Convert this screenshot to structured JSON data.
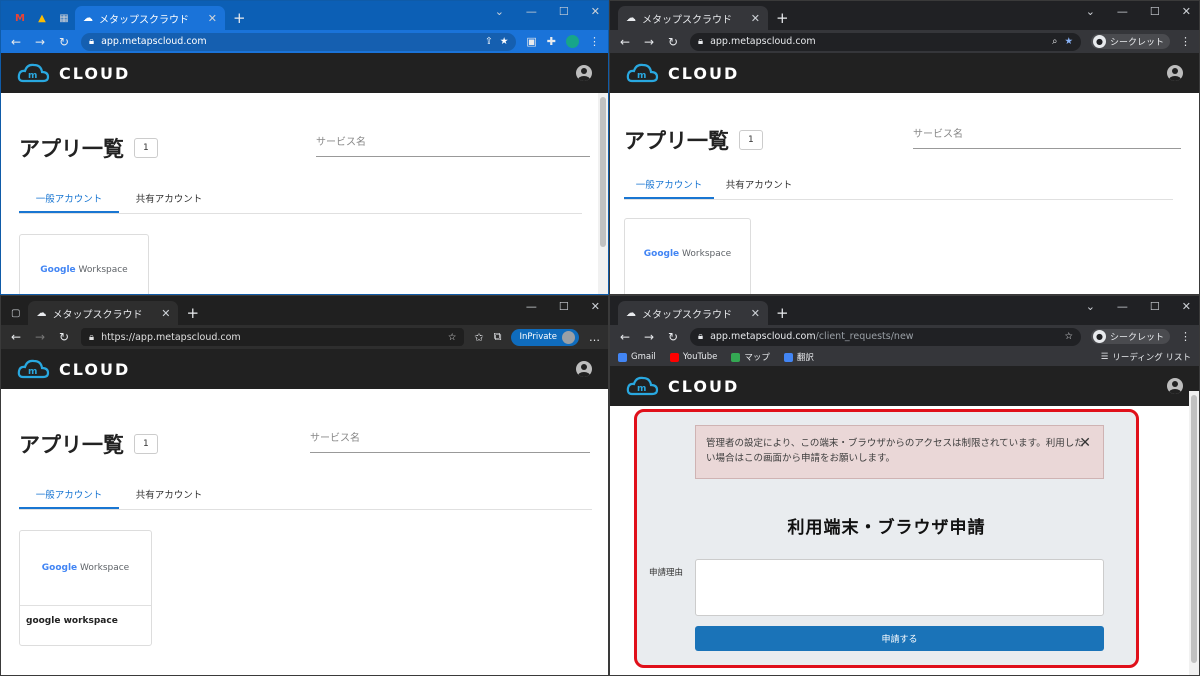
{
  "app": {
    "brand": "CLOUD",
    "page_title": "アプリ一覧",
    "count": "1",
    "search_placeholder": "サービス名",
    "tabs": [
      "一般アカウント",
      "共有アカウント"
    ],
    "card_logo_google": "Google",
    "card_logo_rest": "Workspace",
    "card_name": "google workspace"
  },
  "window1": {
    "pinned_tabs": [
      "M",
      "▲",
      "▦"
    ],
    "tab_title": "メタップスクラウド",
    "url": "app.metapscloud.com"
  },
  "window2": {
    "tab_title": "メタップスクラウド",
    "url": "app.metapscloud.com",
    "secret_label": "シークレット"
  },
  "window3": {
    "tab_title": "メタップスクラウド",
    "url": "https://app.metapscloud.com",
    "inprivate_label": "InPrivate"
  },
  "window4": {
    "tab_title": "メタップスクラウド",
    "url_host": "app.metapscloud.com",
    "url_path": "/client_requests/new",
    "secret_label": "シークレット",
    "bookmarks": [
      {
        "label": "Gmail",
        "color": "#4285f4"
      },
      {
        "label": "YouTube",
        "color": "#ff0000"
      },
      {
        "label": "マップ",
        "color": "#34a853"
      },
      {
        "label": "翻訳",
        "color": "#4285f4"
      }
    ],
    "reading_list": "リーディング リスト",
    "alert_text": "管理者の設定により、この端末・ブラウザからのアクセスは制限されています。利用したい場合はこの画面から申請をお願いします。",
    "form_title": "利用端末・ブラウザ申請",
    "reason_label": "申請理由",
    "reason_value": "",
    "submit_label": "申請する"
  },
  "colors": {
    "accent": "#1976d2",
    "header_bg": "#212121",
    "highlight_border": "#e0101a",
    "submit_bg": "#1a73b8"
  }
}
